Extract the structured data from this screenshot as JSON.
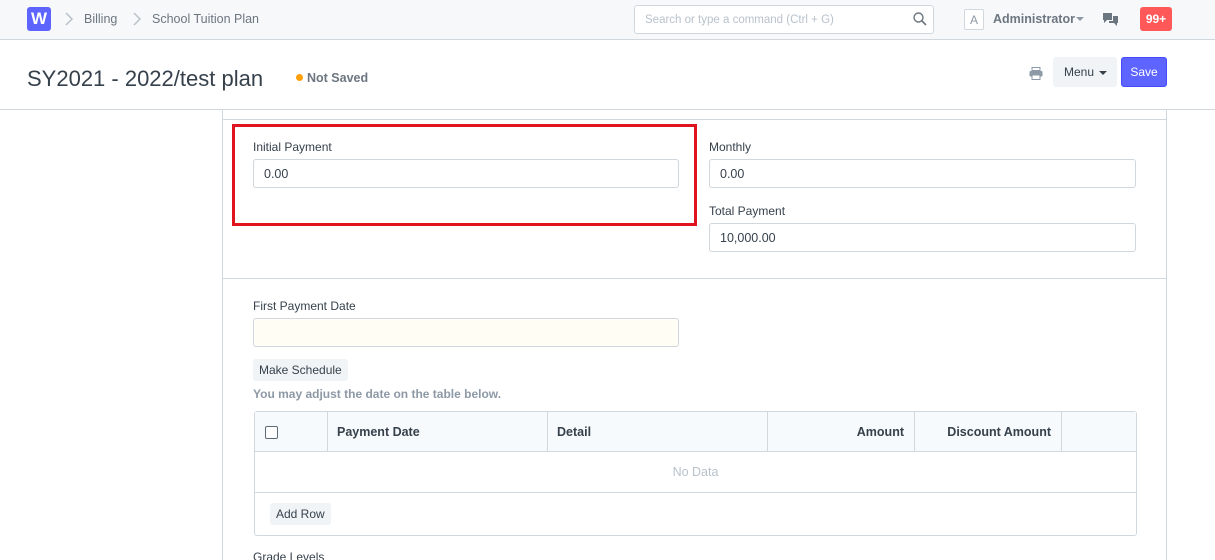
{
  "navbar": {
    "logo_letter": "W",
    "breadcrumbs": [
      "Billing",
      "School Tuition Plan"
    ],
    "search_placeholder": "Search or type a command (Ctrl + G)",
    "avatar_letter": "A",
    "user_name": "Administrator",
    "notification_count": "99+"
  },
  "page": {
    "title": "SY2021 - 2022/test plan",
    "status": "Not Saved",
    "status_color": "#ffa00a",
    "menu_label": "Menu",
    "save_label": "Save",
    "accent_color": "#5e64ff"
  },
  "form": {
    "initial_payment_label": "Initial Payment",
    "initial_payment_value": "0.00",
    "monthly_label": "Monthly",
    "monthly_value": "0.00",
    "total_payment_label": "Total Payment",
    "total_payment_value": "10,000.00",
    "first_payment_date_label": "First Payment Date",
    "first_payment_date_value": "",
    "make_schedule_label": "Make Schedule",
    "schedule_help": "You may adjust the date on the table below.",
    "grade_levels_label": "Grade Levels"
  },
  "grid": {
    "columns": [
      "Payment Date",
      "Detail",
      "Amount",
      "Discount Amount"
    ],
    "empty_text": "No Data",
    "add_row_label": "Add Row"
  }
}
